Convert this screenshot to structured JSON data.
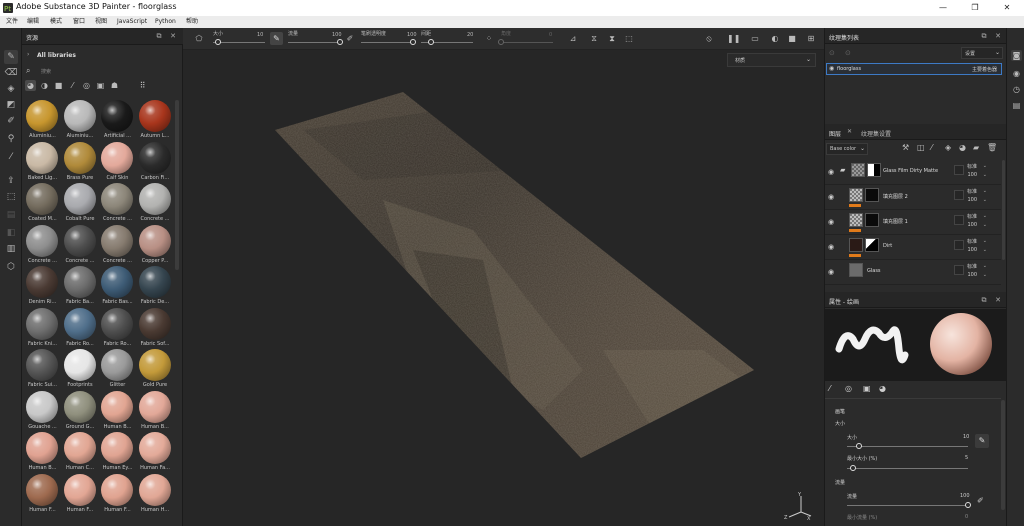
{
  "window": {
    "title": "Adobe Substance 3D Painter - floorglass",
    "minimize": "—",
    "maximize": "❐",
    "close": "✕"
  },
  "menu": [
    "文件",
    "编辑",
    "模式",
    "窗口",
    "视图",
    "JavaScript",
    "Python",
    "帮助"
  ],
  "toolbar": {
    "size_label": "大小",
    "size_value": "10",
    "size_fraction": 0.1,
    "flow_label": "流量",
    "flow_value": "100",
    "flow_fraction": 1.0,
    "opacity_label": "笔刷透明度",
    "opacity_value": "100",
    "opacity_fraction": 1.0,
    "spacing_label": "间距",
    "spacing_value": "20",
    "spacing_fraction": 0.2,
    "angle_label": "角度",
    "angle_value": "0",
    "angle_fraction": 0.0
  },
  "assets": {
    "panel_title": "资源",
    "library": "All libraries",
    "search_placeholder": "搜索",
    "materials": [
      {
        "name": "Aluminiu...",
        "color": "#c7962e"
      },
      {
        "name": "Aluminiu...",
        "color": "#b9b9b9"
      },
      {
        "name": "Artificial ...",
        "color": "#1a1a1a"
      },
      {
        "name": "Autumn L...",
        "color": "#a8351c"
      },
      {
        "name": "Baked Lig...",
        "color": "#c9b9a5"
      },
      {
        "name": "Brass Pure",
        "color": "#b08a3a"
      },
      {
        "name": "Calf Skin",
        "color": "#e3a99b"
      },
      {
        "name": "Carbon Fi...",
        "color": "#2b2b2b"
      },
      {
        "name": "Coated M...",
        "color": "#746c5e"
      },
      {
        "name": "Cobalt Pure",
        "color": "#a9aaae"
      },
      {
        "name": "Concrete ...",
        "color": "#8c8679"
      },
      {
        "name": "Concrete ...",
        "color": "#b2b2b0"
      },
      {
        "name": "Concrete ...",
        "color": "#8e8e8e"
      },
      {
        "name": "Concrete ...",
        "color": "#4d4d4d"
      },
      {
        "name": "Concrete ...",
        "color": "#867b6f"
      },
      {
        "name": "Copper P...",
        "color": "#b88f84"
      },
      {
        "name": "Denim Ri...",
        "color": "#4a3a33"
      },
      {
        "name": "Fabric Ba...",
        "color": "#6c6c6c"
      },
      {
        "name": "Fabric Bas...",
        "color": "#3d5b75"
      },
      {
        "name": "Fabric De...",
        "color": "#35454f"
      },
      {
        "name": "Fabric Kni...",
        "color": "#6e6e6e"
      },
      {
        "name": "Fabric Ro...",
        "color": "#4f6e8a"
      },
      {
        "name": "Fabric Ro...",
        "color": "#4e4e4e"
      },
      {
        "name": "Fabric Sof...",
        "color": "#4a3a32"
      },
      {
        "name": "Fabric Sui...",
        "color": "#555555"
      },
      {
        "name": "Footprints",
        "color": "#e6e6e6"
      },
      {
        "name": "Glitter",
        "color": "#9a9a9a"
      },
      {
        "name": "Gold Pure",
        "color": "#c39a3a"
      },
      {
        "name": "Gouache ...",
        "color": "#c8c8c8"
      },
      {
        "name": "Ground G...",
        "color": "#8f8f7d"
      },
      {
        "name": "Human B...",
        "color": "#e1a592"
      },
      {
        "name": "Human B...",
        "color": "#e2a898"
      },
      {
        "name": "Human B...",
        "color": "#e0a291"
      },
      {
        "name": "Human C...",
        "color": "#e1a693"
      },
      {
        "name": "Human Ey...",
        "color": "#e0a492"
      },
      {
        "name": "Human Fa...",
        "color": "#e3aa99"
      },
      {
        "name": "Human F...",
        "color": "#9e6a4f"
      },
      {
        "name": "Human F...",
        "color": "#e2a694"
      },
      {
        "name": "Human F...",
        "color": "#e0a390"
      },
      {
        "name": "Human H...",
        "color": "#e1a795"
      }
    ]
  },
  "viewport": {
    "dropdown": "材质"
  },
  "texture_sets": {
    "title": "纹理集列表",
    "settings": "设置",
    "item_name": "floorglass",
    "item_shader": "主要着色器"
  },
  "layers": {
    "tab_layers": "图层",
    "tab_settings": "纹理集设置",
    "channel": "Base color",
    "items": [
      {
        "name": "Glass Film Dirty Matte",
        "blend": "标准",
        "opacity": "100",
        "type": "folder"
      },
      {
        "name": "填充图层 2",
        "blend": "标准",
        "opacity": "100",
        "type": "fill"
      },
      {
        "name": "填充图层 1",
        "blend": "标准",
        "opacity": "100",
        "type": "fill"
      },
      {
        "name": "Dirt",
        "blend": "标准",
        "opacity": "100",
        "type": "mask"
      },
      {
        "name": "Glass",
        "blend": "标准",
        "opacity": "100",
        "type": "mat"
      }
    ]
  },
  "properties": {
    "title": "属性 - 绘画",
    "section_brush": "画笔",
    "size_group": "大小",
    "size_label": "大小",
    "size_value": "10",
    "size_fraction": 0.1,
    "min_size_label": "最小大小 (%)",
    "min_size_value": "5",
    "min_size_fraction": 0.05,
    "flow_group": "流量",
    "flow_label": "流量",
    "flow_value": "100",
    "flow_fraction": 1.0,
    "min_flow_label": "最小流量 (%)",
    "min_flow_value": "0"
  },
  "colors": {
    "accent_orange": "#e07a1a",
    "selection_blue": "#3d7ac6",
    "panel_bg": "#2b2b2b",
    "viewport_bg": "#262626"
  }
}
